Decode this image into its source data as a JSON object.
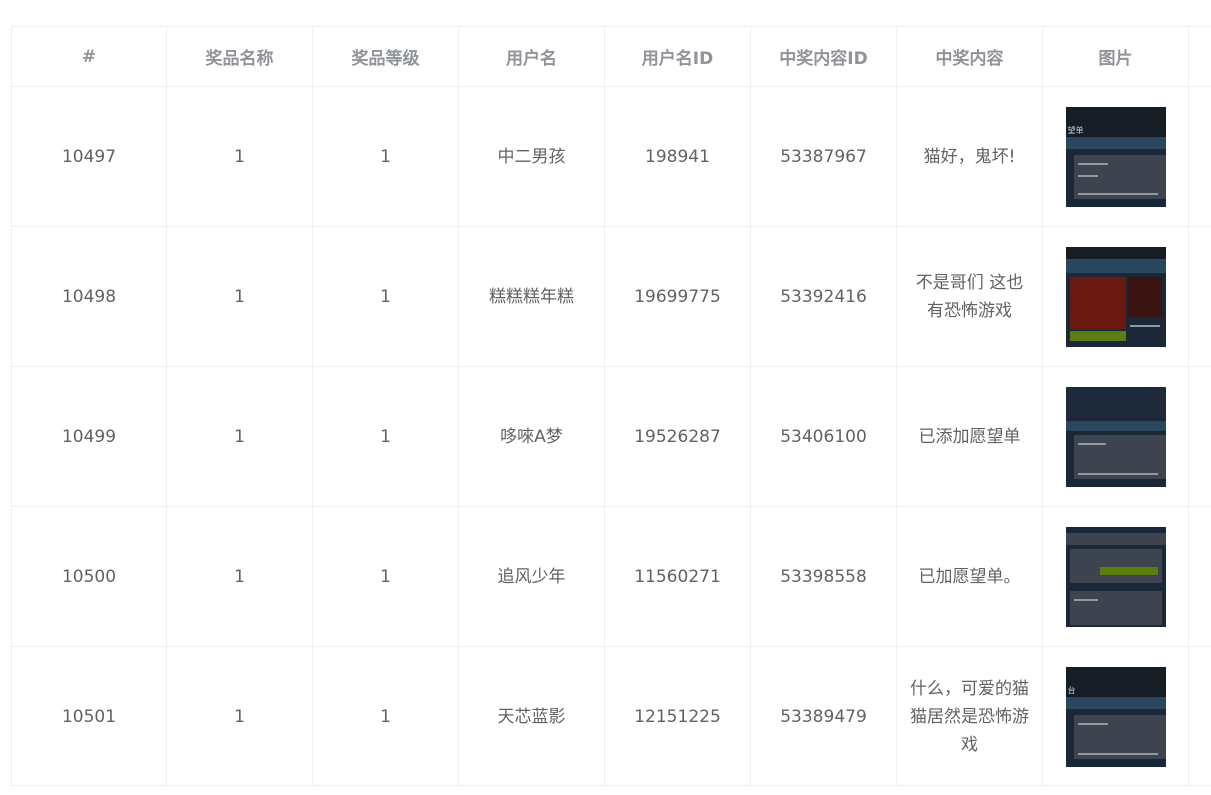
{
  "table": {
    "columns": [
      "#",
      "奖品名称",
      "奖品等级",
      "用户名",
      "用户名ID",
      "中奖内容ID",
      "中奖内容",
      "图片"
    ],
    "rows": [
      {
        "id": "10497",
        "prize_name": "1",
        "prize_level": "1",
        "username": "中二男孩",
        "user_id": "198941",
        "content_id": "53387967",
        "content": "猫好，鬼坏!",
        "thumb_caption": "望单"
      },
      {
        "id": "10498",
        "prize_name": "1",
        "prize_level": "1",
        "username": "糕糕糕年糕",
        "user_id": "19699775",
        "content_id": "53392416",
        "content": "不是哥们 这也有恐怖游戏",
        "thumb_caption": ""
      },
      {
        "id": "10499",
        "prize_name": "1",
        "prize_level": "1",
        "username": "哆唻A梦",
        "user_id": "19526287",
        "content_id": "53406100",
        "content": "已添加愿望单",
        "thumb_caption": ""
      },
      {
        "id": "10500",
        "prize_name": "1",
        "prize_level": "1",
        "username": "追风少年",
        "user_id": "11560271",
        "content_id": "53398558",
        "content": "已加愿望单。",
        "thumb_caption": ""
      },
      {
        "id": "10501",
        "prize_name": "1",
        "prize_level": "1",
        "username": "天芯蓝影",
        "user_id": "12151225",
        "content_id": "53389479",
        "content": "什么，可爱的猫猫居然是恐怖游戏",
        "thumb_caption": "台"
      }
    ]
  }
}
